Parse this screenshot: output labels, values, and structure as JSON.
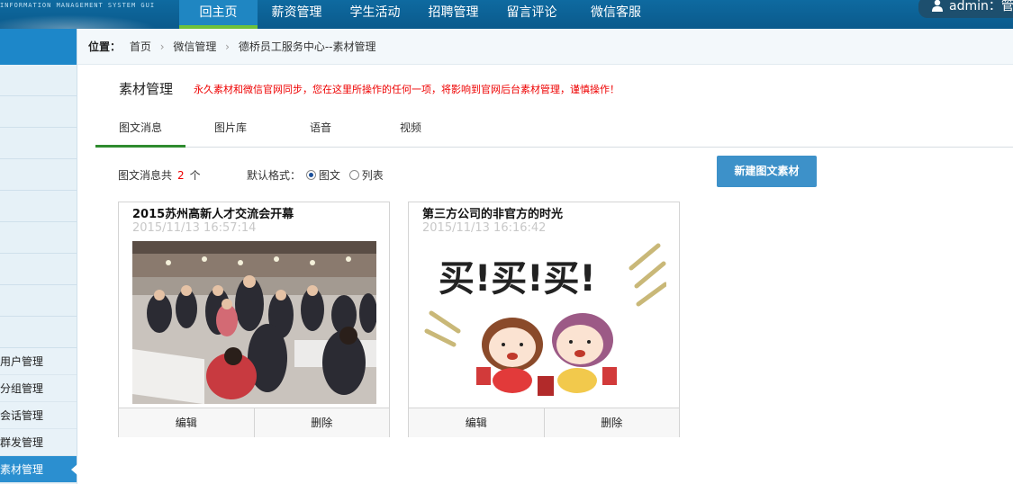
{
  "header": {
    "logo_text": "INFORMATION MANAGEMENT SYSTEM GUI",
    "nav": [
      "回主页",
      "薪资管理",
      "学生活动",
      "招聘管理",
      "留言评论",
      "微信客服"
    ],
    "active_nav": "回主页",
    "user_text": "admin：管理"
  },
  "sidebar": {
    "items": [
      "用户管理",
      "分组管理",
      "会话管理",
      "群发管理",
      "素材管理"
    ],
    "active": "素材管理"
  },
  "breadcrumb": {
    "label": "位置：",
    "items": [
      "首页",
      "微信管理",
      "德桥员工服务中心--素材管理"
    ]
  },
  "main": {
    "title": "素材管理",
    "warning": "永久素材和微信官网同步，您在这里所操作的任何一项，将影响到官网后台素材管理，谨慎操作！",
    "tabs": [
      "图文消息",
      "图片库",
      "语音",
      "视频"
    ],
    "active_tab": "图文消息",
    "count_prefix": "图文消息共",
    "count_value": "2",
    "count_suffix": "个",
    "format_label": "默认格式：",
    "format_options": [
      "图文",
      "列表"
    ],
    "format_selected": "图文",
    "new_button": "新建图文素材"
  },
  "cards": [
    {
      "title": "2015苏州高新人才交流会开幕",
      "date": "2015/11/13 16:57:14",
      "image": "crowd-photo",
      "edit": "编辑",
      "delete": "删除"
    },
    {
      "title": "第三方公司的非官方的时光",
      "date": "2015/11/13 16:16:42",
      "image": "cartoon-shopping-girls",
      "image_text": "买!买!买!",
      "edit": "编辑",
      "delete": "删除"
    }
  ],
  "colors": {
    "topbar": "#0b5a8c",
    "active_nav_underline": "#6ec13a",
    "warning": "#ee0000",
    "button": "#3d91c9",
    "sidebar_active": "#2b8fd0"
  }
}
